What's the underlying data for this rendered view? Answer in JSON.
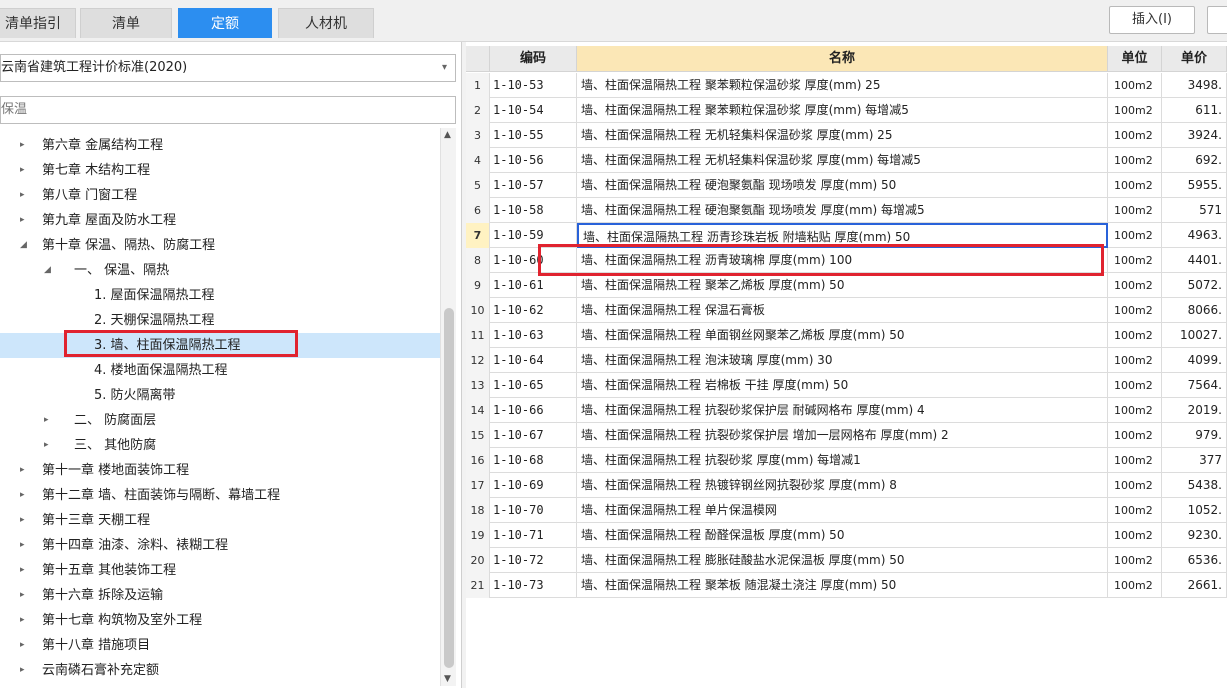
{
  "tabs": [
    {
      "label": "清单指引",
      "active": false
    },
    {
      "label": "清单",
      "active": false
    },
    {
      "label": "定额",
      "active": true
    },
    {
      "label": "人材机",
      "active": false
    }
  ],
  "toolbar": {
    "insert_label": "插入(I)"
  },
  "left_panel": {
    "standard_selected": "云南省建筑工程计价标准(2020)",
    "search_value": "保温",
    "tree": [
      {
        "label": "第六章 金属结构工程",
        "arrow": "▸",
        "level": 0
      },
      {
        "label": "第七章 木结构工程",
        "arrow": "▸",
        "level": 0
      },
      {
        "label": "第八章 门窗工程",
        "arrow": "▸",
        "level": 0
      },
      {
        "label": "第九章 屋面及防水工程",
        "arrow": "▸",
        "level": 0
      },
      {
        "label": "第十章 保温、隔热、防腐工程",
        "arrow": "◢",
        "level": 0
      },
      {
        "label": "一、 保温、隔热",
        "arrow": "◢",
        "level": 1
      },
      {
        "label": "1. 屋面保温隔热工程",
        "arrow": "",
        "level": 2
      },
      {
        "label": "2. 天棚保温隔热工程",
        "arrow": "",
        "level": 2
      },
      {
        "label": "3. 墙、柱面保温隔热工程",
        "arrow": "",
        "level": 2,
        "selected": true
      },
      {
        "label": "4. 楼地面保温隔热工程",
        "arrow": "",
        "level": 2
      },
      {
        "label": "5. 防火隔离带",
        "arrow": "",
        "level": 2
      },
      {
        "label": "二、 防腐面层",
        "arrow": "▸",
        "level": 1
      },
      {
        "label": "三、 其他防腐",
        "arrow": "▸",
        "level": 1
      },
      {
        "label": "第十一章 楼地面装饰工程",
        "arrow": "▸",
        "level": 0
      },
      {
        "label": "第十二章 墙、柱面装饰与隔断、幕墙工程",
        "arrow": "▸",
        "level": 0
      },
      {
        "label": "第十三章 天棚工程",
        "arrow": "▸",
        "level": 0
      },
      {
        "label": "第十四章 油漆、涂料、裱糊工程",
        "arrow": "▸",
        "level": 0
      },
      {
        "label": "第十五章 其他装饰工程",
        "arrow": "▸",
        "level": 0
      },
      {
        "label": "第十六章 拆除及运输",
        "arrow": "▸",
        "level": 0
      },
      {
        "label": "第十七章 构筑物及室外工程",
        "arrow": "▸",
        "level": 0
      },
      {
        "label": "第十八章 措施项目",
        "arrow": "▸",
        "level": 0
      },
      {
        "label": "云南磷石膏补充定额",
        "arrow": "▸",
        "level": 0
      }
    ]
  },
  "grid": {
    "headers": {
      "code": "编码",
      "name": "名称",
      "unit": "单位",
      "price": "单价"
    },
    "current_row": 7,
    "rows": [
      {
        "idx": "1",
        "code": "1-10-53",
        "name": "墙、柱面保温隔热工程 聚苯颗粒保温砂浆 厚度(mm) 25",
        "unit": "100m2",
        "price": "3498."
      },
      {
        "idx": "2",
        "code": "1-10-54",
        "name": "墙、柱面保温隔热工程 聚苯颗粒保温砂浆 厚度(mm) 每增减5",
        "unit": "100m2",
        "price": "611."
      },
      {
        "idx": "3",
        "code": "1-10-55",
        "name": "墙、柱面保温隔热工程 无机轻集料保温砂浆 厚度(mm) 25",
        "unit": "100m2",
        "price": "3924."
      },
      {
        "idx": "4",
        "code": "1-10-56",
        "name": "墙、柱面保温隔热工程 无机轻集料保温砂浆 厚度(mm) 每增减5",
        "unit": "100m2",
        "price": "692."
      },
      {
        "idx": "5",
        "code": "1-10-57",
        "name": "墙、柱面保温隔热工程 硬泡聚氨酯 现场喷发 厚度(mm) 50",
        "unit": "100m2",
        "price": "5955."
      },
      {
        "idx": "6",
        "code": "1-10-58",
        "name": "墙、柱面保温隔热工程 硬泡聚氨酯 现场喷发 厚度(mm) 每增减5",
        "unit": "100m2",
        "price": "571"
      },
      {
        "idx": "7",
        "code": "1-10-59",
        "name": "墙、柱面保温隔热工程 沥青珍珠岩板 附墙粘贴 厚度(mm) 50",
        "unit": "100m2",
        "price": "4963."
      },
      {
        "idx": "8",
        "code": "1-10-60",
        "name": "墙、柱面保温隔热工程 沥青玻璃棉 厚度(mm) 100",
        "unit": "100m2",
        "price": "4401."
      },
      {
        "idx": "9",
        "code": "1-10-61",
        "name": "墙、柱面保温隔热工程 聚苯乙烯板 厚度(mm) 50",
        "unit": "100m2",
        "price": "5072."
      },
      {
        "idx": "10",
        "code": "1-10-62",
        "name": "墙、柱面保温隔热工程 保温石膏板",
        "unit": "100m2",
        "price": "8066."
      },
      {
        "idx": "11",
        "code": "1-10-63",
        "name": "墙、柱面保温隔热工程 单面钢丝网聚苯乙烯板 厚度(mm) 50",
        "unit": "100m2",
        "price": "10027."
      },
      {
        "idx": "12",
        "code": "1-10-64",
        "name": "墙、柱面保温隔热工程 泡沫玻璃 厚度(mm) 30",
        "unit": "100m2",
        "price": "4099."
      },
      {
        "idx": "13",
        "code": "1-10-65",
        "name": "墙、柱面保温隔热工程 岩棉板 干挂 厚度(mm) 50",
        "unit": "100m2",
        "price": "7564."
      },
      {
        "idx": "14",
        "code": "1-10-66",
        "name": "墙、柱面保温隔热工程 抗裂砂浆保护层 耐碱网格布 厚度(mm) 4",
        "unit": "100m2",
        "price": "2019."
      },
      {
        "idx": "15",
        "code": "1-10-67",
        "name": "墙、柱面保温隔热工程 抗裂砂浆保护层 增加一层网格布 厚度(mm) 2",
        "unit": "100m2",
        "price": "979."
      },
      {
        "idx": "16",
        "code": "1-10-68",
        "name": "墙、柱面保温隔热工程 抗裂砂浆 厚度(mm) 每增减1",
        "unit": "100m2",
        "price": "377"
      },
      {
        "idx": "17",
        "code": "1-10-69",
        "name": "墙、柱面保温隔热工程 热镀锌钢丝网抗裂砂浆 厚度(mm) 8",
        "unit": "100m2",
        "price": "5438."
      },
      {
        "idx": "18",
        "code": "1-10-70",
        "name": "墙、柱面保温隔热工程 单片保温模网",
        "unit": "100m2",
        "price": "1052."
      },
      {
        "idx": "19",
        "code": "1-10-71",
        "name": "墙、柱面保温隔热工程 酚醛保温板 厚度(mm) 50",
        "unit": "100m2",
        "price": "9230."
      },
      {
        "idx": "20",
        "code": "1-10-72",
        "name": "墙、柱面保温隔热工程 膨胀硅酸盐水泥保温板 厚度(mm) 50",
        "unit": "100m2",
        "price": "6536."
      },
      {
        "idx": "21",
        "code": "1-10-73",
        "name": "墙、柱面保温隔热工程 聚苯板 随混凝土浇注 厚度(mm) 50",
        "unit": "100m2",
        "price": "2661."
      }
    ]
  }
}
